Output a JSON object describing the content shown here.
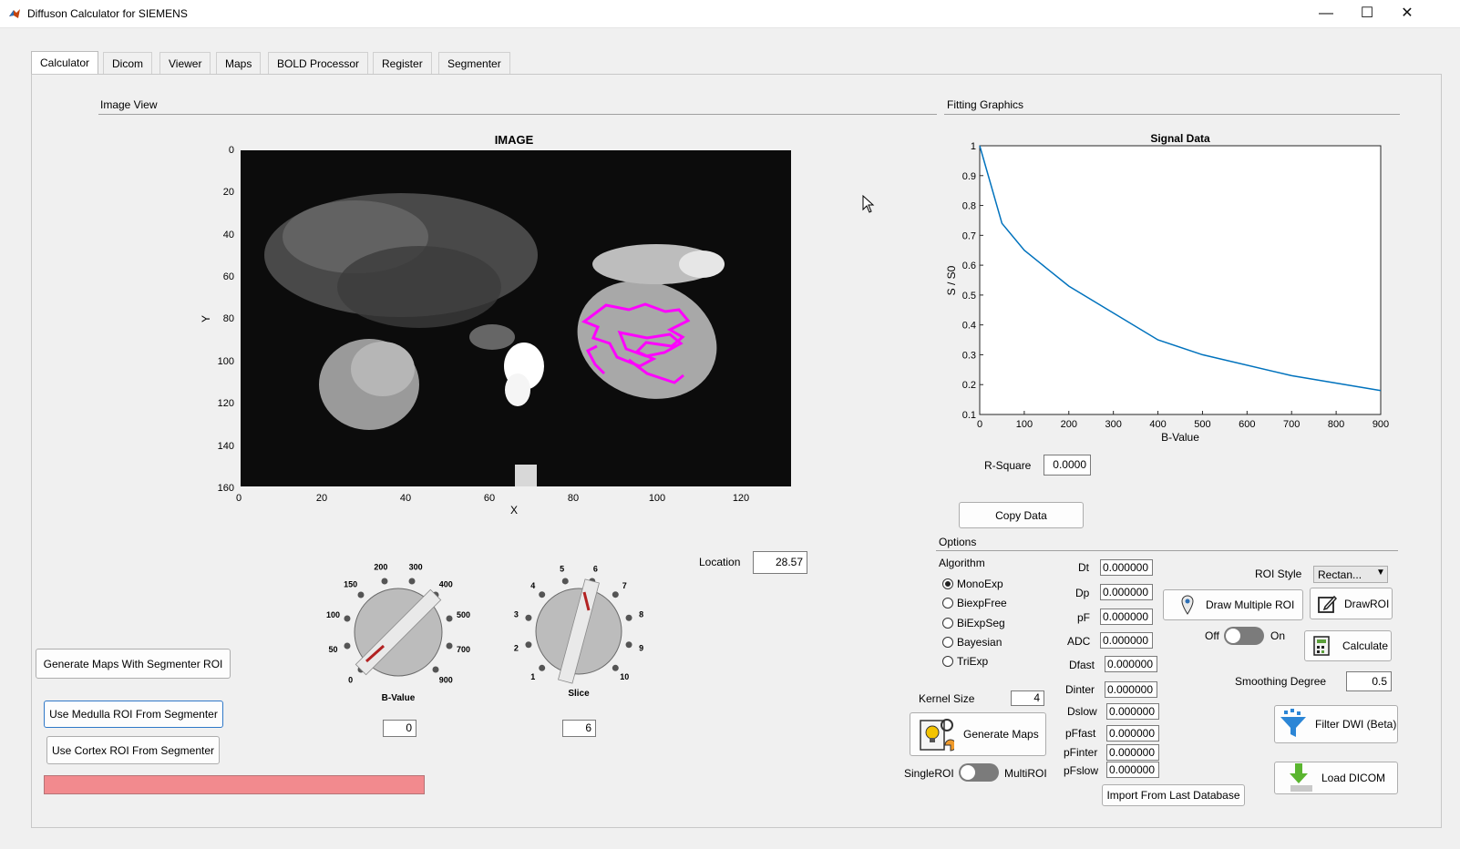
{
  "window": {
    "title": "Diffuson Calculator for SIEMENS",
    "minimize": "—",
    "maximize": "☐",
    "close": "✕"
  },
  "tabs": [
    "Calculator",
    "Dicom",
    "Viewer",
    "Maps",
    "BOLD Processor",
    "Register",
    "Segmenter"
  ],
  "image_view": {
    "section_title": "Image View",
    "plot_title": "IMAGE",
    "xlabel": "X",
    "ylabel": "Y",
    "xticks": [
      "0",
      "20",
      "40",
      "60",
      "80",
      "100",
      "120"
    ],
    "yticks": [
      "0",
      "20",
      "40",
      "60",
      "80",
      "100",
      "120",
      "140",
      "160"
    ]
  },
  "fitting": {
    "section_title": "Fitting Graphics",
    "r_square_label": "R-Square",
    "r_square_value": "0.0000",
    "copy_button": "Copy Data"
  },
  "chart_data": {
    "type": "line",
    "title": "Signal Data",
    "xlabel": "B-Value",
    "ylabel": "S / S0",
    "xlim": [
      0,
      900
    ],
    "ylim": [
      0.1,
      1
    ],
    "xticks": [
      "0",
      "100",
      "200",
      "300",
      "400",
      "500",
      "600",
      "700",
      "800",
      "900"
    ],
    "yticks": [
      "0.1",
      "0.2",
      "0.3",
      "0.4",
      "0.5",
      "0.6",
      "0.7",
      "0.8",
      "0.9",
      "1"
    ],
    "grid": false,
    "series": [
      {
        "color": "#0072bd",
        "x": [
          0,
          50,
          100,
          150,
          200,
          300,
          400,
          500,
          700,
          900
        ],
        "values": [
          1.0,
          0.74,
          0.65,
          0.59,
          0.53,
          0.44,
          0.35,
          0.3,
          0.23,
          0.18
        ]
      }
    ]
  },
  "knobs": {
    "bvalue": {
      "label": "B-Value",
      "value": "0",
      "ticks": [
        "0",
        "50",
        "100",
        "150",
        "200",
        "300",
        "400",
        "500",
        "700",
        "900"
      ]
    },
    "slice": {
      "label": "Slice",
      "value": "6",
      "ticks": [
        "1",
        "2",
        "3",
        "4",
        "5",
        "6",
        "7",
        "8",
        "9",
        "10"
      ]
    }
  },
  "location": {
    "label": "Location",
    "value": "28.57"
  },
  "left_buttons": {
    "generate_maps_seg": "Generate Maps With Segmenter ROI",
    "medulla": "Use Medulla ROI From Segmenter",
    "cortex": "Use Cortex ROI From Segmenter"
  },
  "options": {
    "section_title": "Options",
    "algorithm_label": "Algorithm",
    "algorithms": [
      "MonoExp",
      "BiexpFree",
      "BiExpSeg",
      "Bayesian",
      "TriExp"
    ],
    "selected_algorithm": "MonoExp",
    "params": [
      {
        "label": "Dt",
        "value": "0.000000"
      },
      {
        "label": "Dp",
        "value": "0.000000"
      },
      {
        "label": "pF",
        "value": "0.000000"
      },
      {
        "label": "ADC",
        "value": "0.000000"
      },
      {
        "label": "Dfast",
        "value": "0.000000"
      },
      {
        "label": "Dinter",
        "value": "0.000000"
      },
      {
        "label": "Dslow",
        "value": "0.000000"
      },
      {
        "label": "pFfast",
        "value": "0.000000"
      },
      {
        "label": "pFinter",
        "value": "0.000000"
      },
      {
        "label": "pFslow",
        "value": "0.000000"
      }
    ],
    "kernel_size_label": "Kernel Size",
    "kernel_size_value": "4",
    "generate_maps": "Generate Maps",
    "single_roi": "SingleROI",
    "multi_roi": "MultiROI",
    "import_button": "Import From Last Database",
    "roi_style_label": "ROI Style",
    "roi_style_value": "Rectan...",
    "draw_multiple_roi": "Draw Multiple ROI",
    "draw_roi": "DrawROI",
    "off_label": "Off",
    "on_label": "On",
    "calculate": "Calculate",
    "smoothing_label": "Smoothing Degree",
    "smoothing_value": "0.5",
    "filter_dwi": "Filter DWI (Beta)",
    "load_dicom": "Load DICOM"
  },
  "colors": {
    "progress_bar": "#f28a8e",
    "signal_line": "#0072bd",
    "roi_outline": "#ff00ff",
    "knob_pointer": "#b22222"
  }
}
